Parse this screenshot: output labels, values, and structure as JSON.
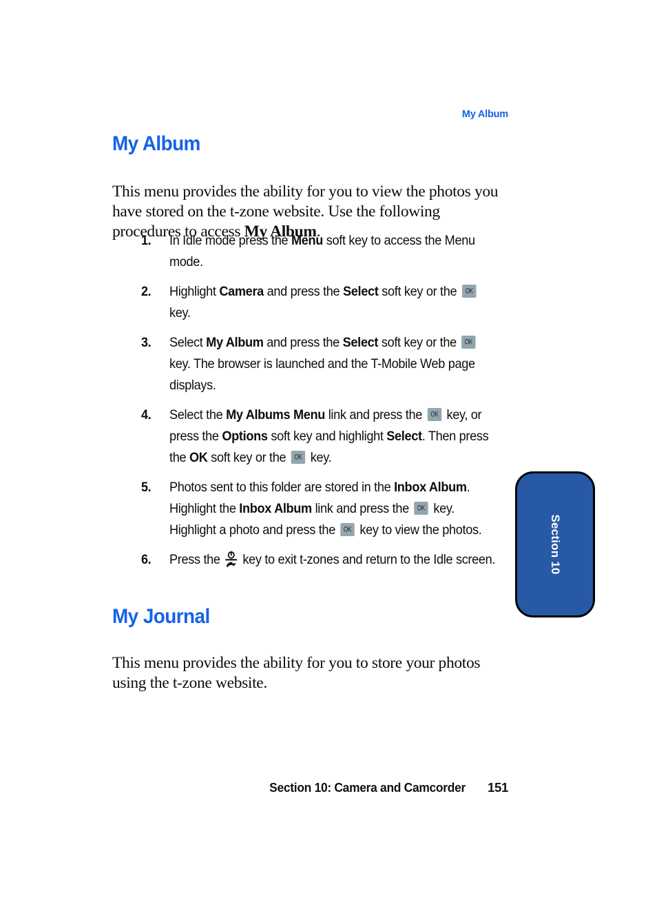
{
  "header": {
    "running_head": "My Album"
  },
  "sections": [
    {
      "heading": "My Album",
      "intro_prefix": "This menu provides the ability for you to view the photos you have stored on the t-zone website. Use the following procedures to access ",
      "intro_bold": "My Album",
      "intro_suffix": "."
    },
    {
      "heading": "My Journal",
      "intro": "This menu provides the ability for you to store your photos using the t-zone website."
    }
  ],
  "steps": [
    {
      "number": "1.",
      "parts": [
        {
          "t": "text",
          "v": "In Idle mode press the "
        },
        {
          "t": "bold",
          "v": "Menu"
        },
        {
          "t": "text",
          "v": " soft key to access the Menu mode."
        }
      ]
    },
    {
      "number": "2.",
      "parts": [
        {
          "t": "text",
          "v": "Highlight "
        },
        {
          "t": "bold",
          "v": "Camera"
        },
        {
          "t": "text",
          "v": " and press the "
        },
        {
          "t": "bold",
          "v": "Select"
        },
        {
          "t": "text",
          "v": " soft key or the "
        },
        {
          "t": "ok-key",
          "v": "OK"
        },
        {
          "t": "text",
          "v": " key."
        }
      ]
    },
    {
      "number": "3.",
      "parts": [
        {
          "t": "text",
          "v": "Select "
        },
        {
          "t": "bold",
          "v": "My Album"
        },
        {
          "t": "text",
          "v": " and press the "
        },
        {
          "t": "bold",
          "v": "Select"
        },
        {
          "t": "text",
          "v": " soft key or the "
        },
        {
          "t": "ok-key",
          "v": "OK"
        },
        {
          "t": "text",
          "v": " key. The browser is launched and the T-Mobile Web page displays."
        }
      ]
    },
    {
      "number": "4.",
      "parts": [
        {
          "t": "text",
          "v": "Select the "
        },
        {
          "t": "bold",
          "v": "My Albums Menu"
        },
        {
          "t": "text",
          "v": " link and press the "
        },
        {
          "t": "ok-key",
          "v": "OK"
        },
        {
          "t": "text",
          "v": " key, or press the "
        },
        {
          "t": "bold",
          "v": "Options"
        },
        {
          "t": "text",
          "v": " soft key and highlight "
        },
        {
          "t": "bold",
          "v": "Select"
        },
        {
          "t": "text",
          "v": ". Then press the "
        },
        {
          "t": "bold",
          "v": "OK"
        },
        {
          "t": "text",
          "v": " soft key or the "
        },
        {
          "t": "ok-key",
          "v": "OK"
        },
        {
          "t": "text",
          "v": " key."
        }
      ]
    },
    {
      "number": "5.",
      "parts": [
        {
          "t": "text",
          "v": "Photos sent to this folder are stored in the "
        },
        {
          "t": "bold",
          "v": "Inbox Album"
        },
        {
          "t": "text",
          "v": ". Highlight the "
        },
        {
          "t": "bold",
          "v": "Inbox Album"
        },
        {
          "t": "text",
          "v": " link and press the "
        },
        {
          "t": "ok-key",
          "v": "OK"
        },
        {
          "t": "text",
          "v": " key. Highlight a photo and press the "
        },
        {
          "t": "ok-key",
          "v": "OK"
        },
        {
          "t": "text",
          "v": " key to view the photos."
        }
      ]
    },
    {
      "number": "6.",
      "parts": [
        {
          "t": "text",
          "v": "Press the "
        },
        {
          "t": "end-key",
          "v": "End"
        },
        {
          "t": "text",
          "v": " key to exit t-zones and return to the Idle screen."
        }
      ]
    }
  ],
  "section_tab": {
    "label": "Section 10",
    "color": "#2759a7"
  },
  "footer": {
    "title": "Section 10: Camera and Camcorder",
    "page_number": "151"
  },
  "colors": {
    "heading_blue": "#1562e6",
    "tab_blue": "#2759a7",
    "ok_key_gray": "#93a6b0",
    "body_text": "#0d0d0d"
  }
}
